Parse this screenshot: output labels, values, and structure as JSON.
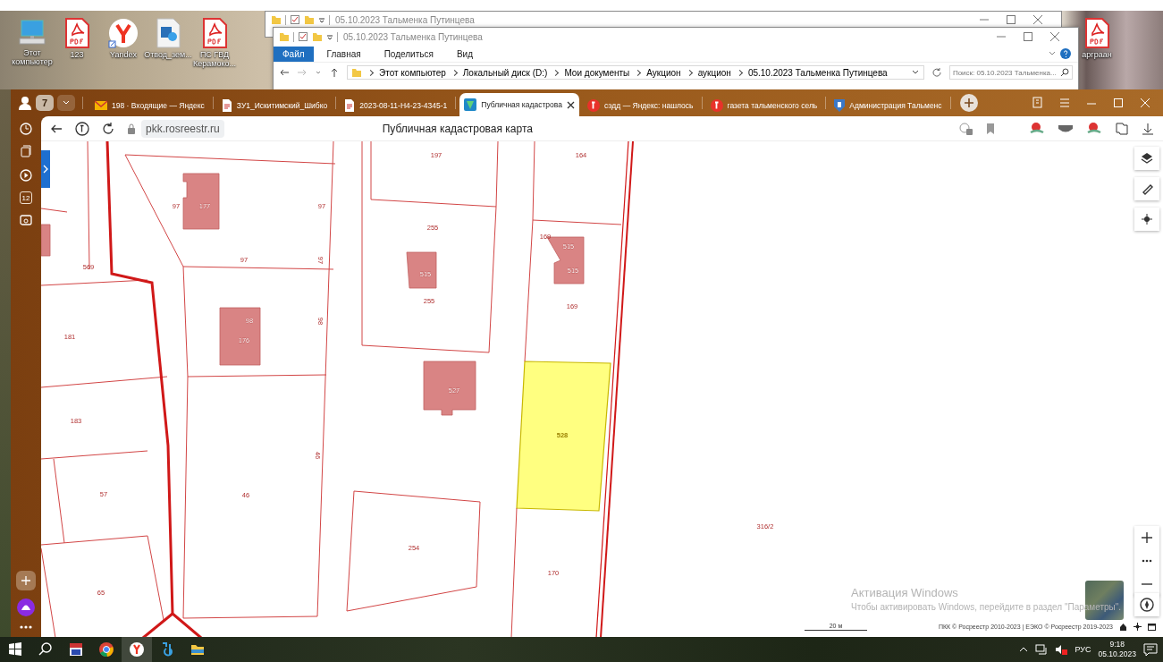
{
  "desktop": {
    "icons": [
      {
        "label": "Этот компьютер",
        "kind": "computer"
      },
      {
        "label": "123",
        "kind": "pdf"
      },
      {
        "label": "Yandex",
        "kind": "yandex"
      },
      {
        "label": "Отвод_зем...",
        "kind": "media"
      },
      {
        "label": "ПС ГВД Керамоко...",
        "kind": "pdf"
      },
      {
        "label": "арграан",
        "kind": "pdf"
      }
    ]
  },
  "explorer_back": {
    "title": "05.10.2023 Тальменка Путинцева"
  },
  "explorer_front": {
    "title": "05.10.2023 Тальменка Путинцева",
    "ribbon_tabs": [
      {
        "label": "Файл",
        "selected": true
      },
      {
        "label": "Главная",
        "selected": false
      },
      {
        "label": "Поделиться",
        "selected": false
      },
      {
        "label": "Вид",
        "selected": false
      }
    ],
    "breadcrumb": [
      "Этот компьютер",
      "Локальный диск (D:)",
      "Мои документы",
      "Аукцион",
      "аукцион",
      "05.10.2023 Тальменка Путинцева"
    ],
    "search": {
      "placeholder": "Поиск: 05.10.2023 Тальменка..."
    }
  },
  "browser": {
    "tab_count": "7",
    "tabs": [
      {
        "label": "198 · Входящие — Яндекс",
        "kind": "mail",
        "selected": false
      },
      {
        "label": "ЗУ1_Искитимский_Шибко",
        "kind": "document",
        "selected": false
      },
      {
        "label": "2023-08-11-Н4-23-4345-1",
        "kind": "document",
        "selected": false
      },
      {
        "label": "Публичная кадастрова",
        "kind": "cadastre",
        "selected": true
      },
      {
        "label": "сэдд — Яндекс: нашлось",
        "kind": "yandex",
        "selected": false
      },
      {
        "label": "газета тальменского сель",
        "kind": "yandex",
        "selected": false
      },
      {
        "label": "Администрация Тальменс",
        "kind": "emblem",
        "selected": false
      }
    ],
    "address": "pkk.rosreestr.ru",
    "page_title": "Публичная кадастровая карта",
    "calendar_day": "12"
  },
  "map": {
    "parcel_labels": [
      {
        "text": "197",
        "kind": "parcel",
        "selected": false
      },
      {
        "text": "164",
        "kind": "parcel",
        "selected": false
      },
      {
        "text": "97",
        "kind": "parcel",
        "selected": false
      },
      {
        "text": "177",
        "kind": "building",
        "selected": false
      },
      {
        "text": "97",
        "kind": "parcel",
        "selected": false
      },
      {
        "text": "255",
        "kind": "parcel",
        "selected": false
      },
      {
        "text": "169",
        "kind": "parcel",
        "selected": false
      },
      {
        "text": "515",
        "kind": "building",
        "selected": false
      },
      {
        "text": "515",
        "kind": "building",
        "selected": false
      },
      {
        "text": "569",
        "kind": "parcel",
        "selected": false
      },
      {
        "text": "97",
        "kind": "parcel",
        "selected": false
      },
      {
        "text": "97",
        "kind": "parcel",
        "selected": false
      },
      {
        "text": "515",
        "kind": "building",
        "selected": false
      },
      {
        "text": "255",
        "kind": "parcel",
        "selected": false
      },
      {
        "text": "169",
        "kind": "parcel",
        "selected": false
      },
      {
        "text": "181",
        "kind": "parcel",
        "selected": false
      },
      {
        "text": "98",
        "kind": "building",
        "selected": false
      },
      {
        "text": "176",
        "kind": "building",
        "selected": false
      },
      {
        "text": "98",
        "kind": "parcel",
        "selected": false
      },
      {
        "text": "527",
        "kind": "building",
        "selected": false
      },
      {
        "text": "183",
        "kind": "parcel",
        "selected": false
      },
      {
        "text": "528",
        "kind": "parcel",
        "selected": true
      },
      {
        "text": "46",
        "kind": "parcel",
        "selected": false
      },
      {
        "text": "57",
        "kind": "parcel",
        "selected": false
      },
      {
        "text": "46",
        "kind": "parcel",
        "selected": false
      },
      {
        "text": "254",
        "kind": "parcel",
        "selected": false
      },
      {
        "text": "316/2",
        "kind": "parcel",
        "selected": false
      },
      {
        "text": "170",
        "kind": "parcel",
        "selected": false
      },
      {
        "text": "65",
        "kind": "parcel",
        "selected": false
      }
    ],
    "scale": "20 м",
    "attribution": "ПКК © Росреестр 2010-2023 | ЕЭКО © Росреестр 2019-2023"
  },
  "activation_notice": {
    "title": "Активация Windows",
    "text": "Чтобы активировать Windows, перейдите в раздел \"Параметры\"."
  },
  "taskbar": {
    "language": "РУС",
    "time": "9:18",
    "date": "05.10.2023"
  }
}
